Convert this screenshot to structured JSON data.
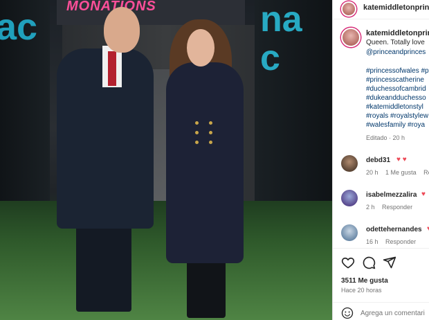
{
  "photo": {
    "banner_text": "MONATIONS",
    "wall_left_text": "ac",
    "wall_right_text": "nac"
  },
  "post": {
    "header_username": "katemiddletonprinc",
    "caption_username": "katemiddletonprince",
    "caption_text": "Queen. Totally love",
    "caption_mention": "@princeandprinces",
    "hashtags": [
      "#princessofwales #p",
      "#princesscatherine",
      "#duchessofcambrid",
      "#dukeandduchesso",
      "#katemiddletonstyl",
      "#royals #royalstylew",
      "#walesfamily #roya"
    ],
    "edited_label": "Editado · 20 h"
  },
  "comments": [
    {
      "username": "debd31",
      "text": "♥ ♥",
      "time": "20 h",
      "likes": "1 Me gusta",
      "reply": "Re"
    },
    {
      "username": "isabelmezzalira",
      "text": "♥",
      "time": "2 h",
      "likes": "",
      "reply": "Responder"
    },
    {
      "username": "odettehernandes",
      "text": "♥",
      "time": "16 h",
      "likes": "",
      "reply": "Responder"
    }
  ],
  "actions": {
    "like_icon": "heart-icon",
    "comment_icon": "comment-icon",
    "share_icon": "share-icon",
    "likes_count": "3511 Me gusta",
    "time_ago": "Hace 20 horas"
  },
  "add_comment": {
    "placeholder": "Agrega un comentari"
  },
  "colors": {
    "link": "#00376b",
    "heart": "#ed4956",
    "meta": "#737373",
    "banner_pink": "#ff4f9a",
    "wall_cyan": "#23b8d8"
  }
}
